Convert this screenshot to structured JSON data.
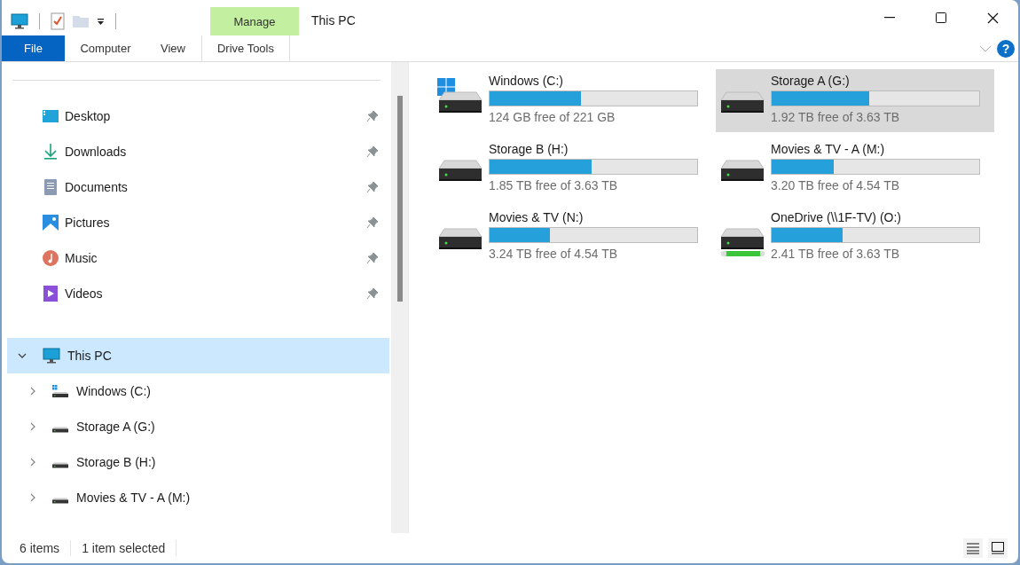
{
  "window": {
    "title": "This PC"
  },
  "ribbon": {
    "tabs": [
      {
        "label": "File",
        "kind": "file"
      },
      {
        "label": "Computer",
        "kind": "normal"
      },
      {
        "label": "View",
        "kind": "normal"
      },
      {
        "label": "Drive Tools",
        "kind": "contextual",
        "group": "Manage"
      }
    ]
  },
  "quick_access": [
    {
      "label": "Desktop",
      "pinned": true
    },
    {
      "label": "Downloads",
      "pinned": true
    },
    {
      "label": "Documents",
      "pinned": true
    },
    {
      "label": "Pictures",
      "pinned": true
    },
    {
      "label": "Music",
      "pinned": true
    },
    {
      "label": "Videos",
      "pinned": true
    }
  ],
  "tree": [
    {
      "label": "This PC",
      "expanded": true,
      "selected": true,
      "children": [
        {
          "label": "Windows (C:)",
          "kind": "windows",
          "expanded": false,
          "selected": false
        },
        {
          "label": "Storage A (G:)",
          "kind": "hdd",
          "expanded": false,
          "selected": false
        },
        {
          "label": "Storage B (H:)",
          "kind": "hdd",
          "expanded": false,
          "selected": false
        },
        {
          "label": "Movies & TV - A (M:)",
          "kind": "hdd",
          "expanded": false,
          "selected": false
        }
      ]
    }
  ],
  "drives": [
    {
      "name": "Windows (C:)",
      "kind": "windows",
      "level": 0.44,
      "free": "124 GB free of 221 GB",
      "selected": false
    },
    {
      "name": "Storage A (G:)",
      "kind": "hdd",
      "level": 0.47,
      "free": "1.92 TB free of 3.63 TB",
      "selected": true
    },
    {
      "name": "Storage B (H:)",
      "kind": "hdd",
      "level": 0.49,
      "free": "1.85 TB free of 3.63 TB",
      "selected": false
    },
    {
      "name": "Movies & TV - A (M:)",
      "kind": "hdd",
      "level": 0.3,
      "free": "3.20 TB free of 4.54 TB",
      "selected": false
    },
    {
      "name": "Movies & TV (N:)",
      "kind": "hdd",
      "level": 0.29,
      "free": "3.24 TB free of 4.54 TB",
      "selected": false
    },
    {
      "name": "OneDrive (\\\\1F-TV) (O:)",
      "kind": "network",
      "level": 0.34,
      "free": "2.41 TB free of 3.63 TB",
      "selected": false
    }
  ],
  "help_button": "?",
  "status_bar": {
    "items": "6 items",
    "selection": "1 item selected"
  }
}
